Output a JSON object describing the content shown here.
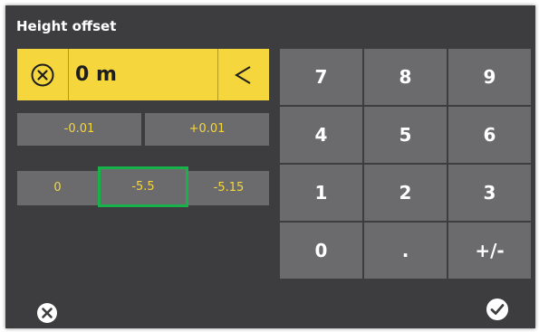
{
  "header": {
    "title": "Height offset"
  },
  "value_display": {
    "value": "0 m",
    "clear_icon": "circle-x-icon",
    "backspace_icon": "chevron-left-icon",
    "backspace_glyph": "<"
  },
  "step_buttons": [
    {
      "label": "-0.01"
    },
    {
      "label": "+0.01"
    }
  ],
  "preset_buttons": [
    {
      "label": "0",
      "selected": false
    },
    {
      "label": "-5.5",
      "selected": true
    },
    {
      "label": "-5.15",
      "selected": false
    }
  ],
  "keypad": {
    "keys": [
      "7",
      "8",
      "9",
      "4",
      "5",
      "6",
      "1",
      "2",
      "3",
      "0",
      ".",
      "+/-"
    ]
  },
  "footer": {
    "cancel_icon": "cancel-circle-icon",
    "confirm_icon": "check-circle-icon"
  },
  "colors": {
    "background": "#3d3d40",
    "accent_yellow": "#f5d63c",
    "button_grey": "#6b6b6e",
    "selection_green": "#17b24a"
  }
}
